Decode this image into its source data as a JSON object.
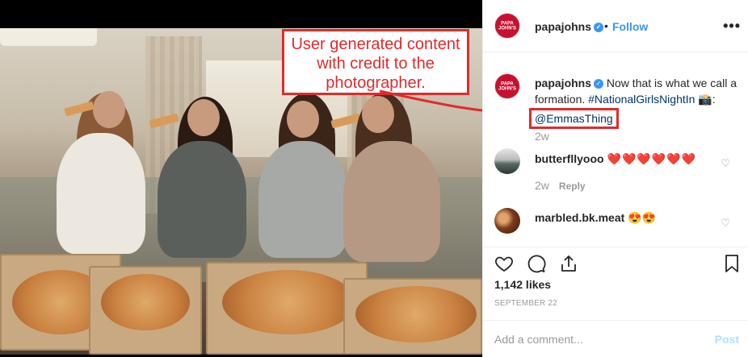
{
  "annotation": {
    "text": "User generated content with credit to the photographer."
  },
  "header": {
    "logo_text": "PAPA JOHN'S",
    "username": "papajohns",
    "verified_glyph": "✓",
    "separator": "•",
    "follow_label": "Follow",
    "more_glyph": "•••"
  },
  "caption": {
    "username": "papajohns",
    "text": "Now that is what we call a formation.",
    "hashtag": "#NationalGirlsNightIn",
    "camera": "📸",
    "colon": ":",
    "mention": "@EmmasThing",
    "time": "2w"
  },
  "comments": [
    {
      "username": "butterfllyooo",
      "text": "❤️❤️❤️❤️❤️❤️",
      "time": "2w",
      "reply_label": "Reply"
    },
    {
      "username": "marbled.bk.meat",
      "text": "😍😍"
    }
  ],
  "likes": "1,142 likes",
  "date": "SEPTEMBER 22",
  "add_comment": {
    "placeholder": "Add a comment...",
    "post_label": "Post"
  },
  "colors": {
    "accent": "#3897f0",
    "annotation_red": "#e02b2b",
    "brand_red": "#c8102e"
  },
  "icons": [
    "heart-icon",
    "comment-icon",
    "share-icon",
    "bookmark-icon",
    "more-options-icon",
    "verified-badge-icon"
  ]
}
